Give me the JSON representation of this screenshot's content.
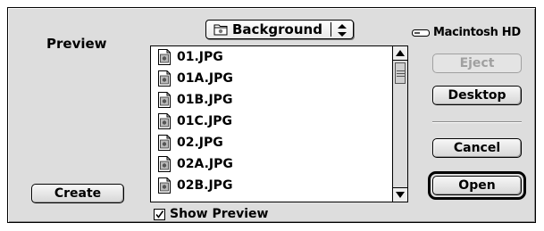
{
  "dialog": {
    "preview_label": "Preview",
    "create_button": "Create",
    "folder_popup": {
      "label": "Background",
      "icon": "folder-icon"
    },
    "volume": {
      "label": "Macintosh HD",
      "icon": "hard-disk-icon"
    },
    "files": [
      "01.JPG",
      "01A.JPG",
      "01B.JPG",
      "01C.JPG",
      "02.JPG",
      "02A.JPG",
      "02B.JPG"
    ],
    "file_icon": "jpeg-document-icon",
    "show_preview": {
      "label": "Show Preview",
      "checked": true
    },
    "buttons": {
      "eject": "Eject",
      "desktop": "Desktop",
      "cancel": "Cancel",
      "open": "Open"
    }
  },
  "colors": {
    "dialog_bg": "#dddddd",
    "border": "#000000",
    "disabled_text": "#a0a0a0"
  }
}
